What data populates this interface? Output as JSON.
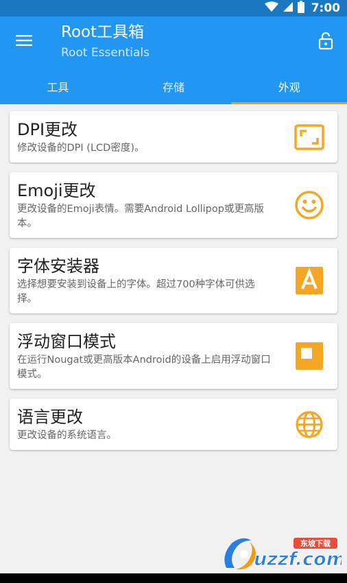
{
  "status_bar": {
    "time": "7:00"
  },
  "app_bar": {
    "title": "Root工具箱",
    "subtitle": "Root Essentials"
  },
  "tabs": [
    {
      "label": "工具",
      "active": false
    },
    {
      "label": "存储",
      "active": false
    },
    {
      "label": "外观",
      "active": true
    }
  ],
  "items": [
    {
      "title": "DPI更改",
      "description": "修改设备的DPI (LCD密度)。",
      "icon": "aspect-ratio-icon"
    },
    {
      "title": "Emoji更改",
      "description": "更改设备的Emoji表情。需要Android Lollipop或更高版本。",
      "icon": "smiley-icon"
    },
    {
      "title": "字体安装器",
      "description": "选择想要安装到设备上的字体。超过700种字体可供选择。",
      "icon": "font-icon"
    },
    {
      "title": "浮动窗口模式",
      "description": "在运行Nougat或更高版本Android的设备上启用浮动窗口模式。",
      "icon": "floating-window-icon"
    },
    {
      "title": "语言更改",
      "description": "更改设备的系统语言。",
      "icon": "globe-icon"
    }
  ],
  "watermark": {
    "text": "uzzf.com",
    "badge": "东坡下载"
  },
  "colors": {
    "status_bar": "#1a78c2",
    "app_bar": "#2196f3",
    "accent": "#ff9800",
    "icon": "#f5a623",
    "background": "#f1f1f1"
  }
}
